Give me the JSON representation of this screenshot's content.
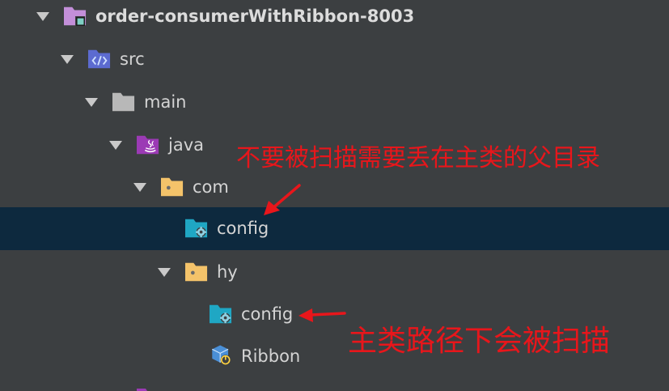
{
  "tree": {
    "root": {
      "label": "order-consumerWithRibbon-8003",
      "icon": "module-folder-icon"
    },
    "src": {
      "label": "src",
      "icon": "source-folder-icon"
    },
    "main": {
      "label": "main",
      "icon": "folder-icon"
    },
    "java": {
      "label": "java",
      "icon": "java-source-folder-icon"
    },
    "com": {
      "label": "com",
      "icon": "package-icon"
    },
    "com_config": {
      "label": "config",
      "icon": "config-package-icon",
      "selected": true
    },
    "hy": {
      "label": "hy",
      "icon": "package-icon"
    },
    "hy_config": {
      "label": "config",
      "icon": "config-package-icon"
    },
    "ribbon": {
      "label": "Ribbon",
      "icon": "spring-boot-class-icon"
    }
  },
  "annotations": {
    "top": "不要被扫描需要丢在主类的父目录",
    "bottom": "主类路径下会被扫描",
    "color": "#e8161b"
  },
  "colors": {
    "background": "#3c3f41",
    "selection": "#0d293e",
    "text": "#d4d4d4"
  }
}
